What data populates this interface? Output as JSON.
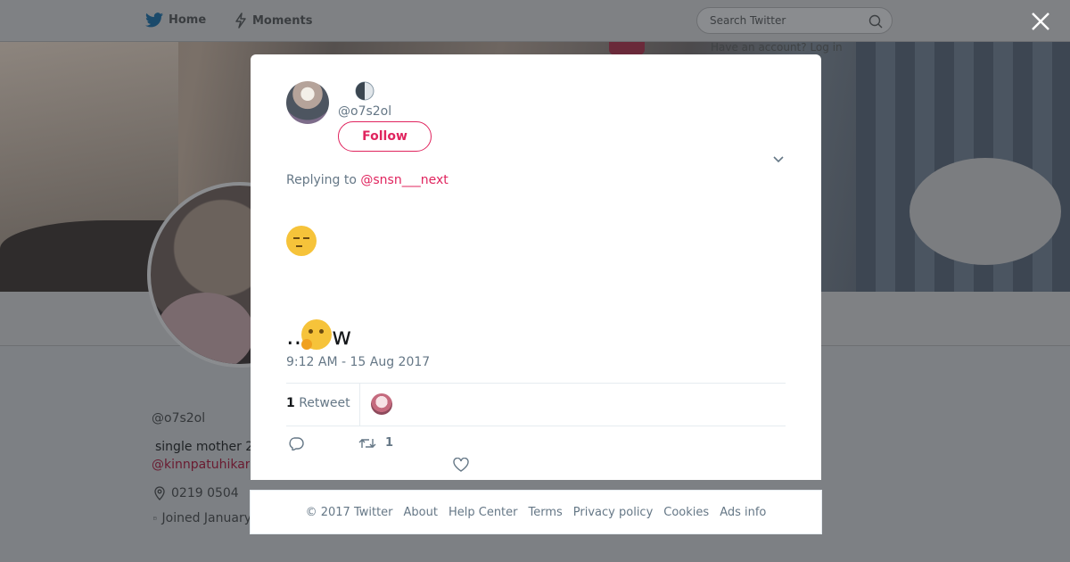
{
  "nav": {
    "home_label": "Home",
    "moments_label": "Moments",
    "search_placeholder": "Search Twitter",
    "have_account": "Have an account? Log in"
  },
  "background_profile": {
    "name": "",
    "handle": "@o7s2ol",
    "bio": "single mother 2",
    "bio_link": "@kinnpatuhikari",
    "location": "0219 0504",
    "joined": "Joined January"
  },
  "tweet": {
    "display_name": "",
    "handle": "@o7s2ol",
    "follow_label": "Follow",
    "replying_prefix": "Replying to ",
    "replying_to": "@snsn___next",
    "line1": "",
    "line2": "",
    "line3": "",
    "line4": "..",
    "line4_suffix": "w",
    "timestamp": "9:12 AM - 15 Aug 2017",
    "retweet_count": "1",
    "retweet_label": "Retweet",
    "action_retweet_count": "1"
  },
  "footer": {
    "copyright": "© 2017 Twitter",
    "links": [
      "About",
      "Help Center",
      "Terms",
      "Privacy policy",
      "Cookies",
      "Ads info"
    ]
  },
  "icons": {
    "twitter": "twitter-bird-icon",
    "moments": "lightning-icon",
    "search": "search-icon",
    "close": "close-icon",
    "chevron": "chevron-down-icon",
    "reply": "reply-icon",
    "retweet": "retweet-icon",
    "like": "heart-icon",
    "location": "location-pin-icon",
    "calendar": "calendar-icon"
  },
  "colors": {
    "accent": "#e0245e",
    "secondary_text": "#657786",
    "primary_text": "#14171a",
    "twitter_blue": "#1da1f2"
  }
}
